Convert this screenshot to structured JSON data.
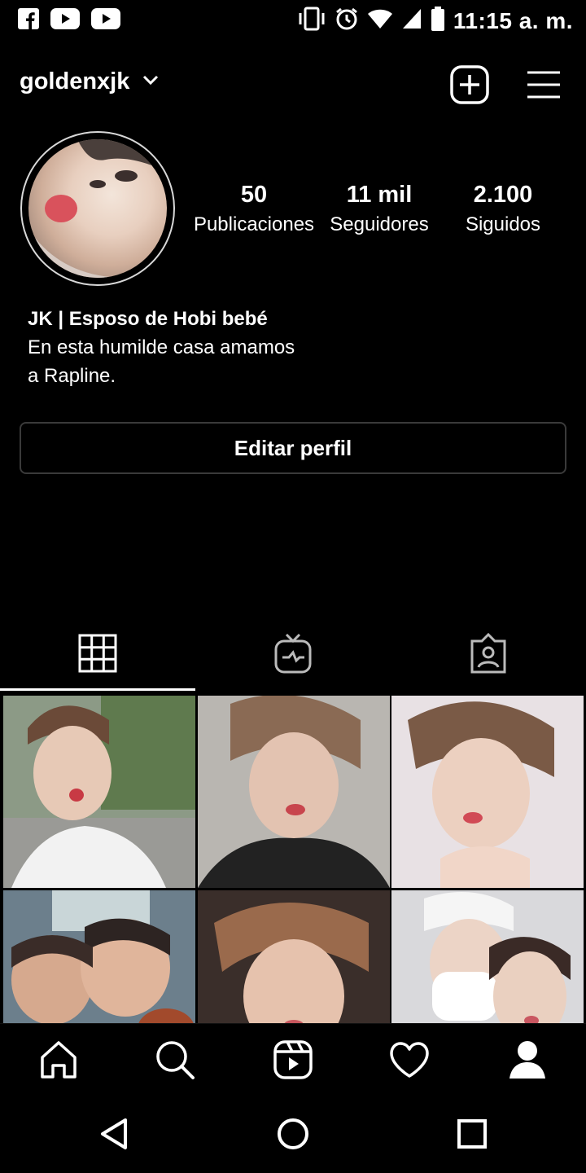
{
  "statusbar": {
    "left_icons": [
      "facebook-icon",
      "youtube-icon",
      "youtube-icon"
    ],
    "right_icons": [
      "vibrate-icon",
      "alarm-icon",
      "wifi-icon",
      "signal-icon",
      "battery-icon"
    ],
    "time": "11:15 a. m."
  },
  "header": {
    "username": "goldenxjk",
    "icons": [
      "chevron-down-icon",
      "add-post-icon",
      "menu-icon"
    ]
  },
  "profile": {
    "stats": [
      {
        "value": "50",
        "label": "Publicaciones"
      },
      {
        "value": "11 mil",
        "label": "Seguidores"
      },
      {
        "value": "2.100",
        "label": "Siguidos"
      }
    ],
    "bio_name": "JK | Esposo de Hobi bebé",
    "bio_line1": "En esta humilde casa amamos",
    "bio_line2": "a Rapline.",
    "edit_button": "Editar perfil"
  },
  "tabs": {
    "items": [
      "grid-icon",
      "igtv-icon",
      "tagged-icon"
    ],
    "active_index": 0
  },
  "bottom_nav": [
    "home-icon",
    "search-icon",
    "reels-icon",
    "heart-icon",
    "profile-icon"
  ],
  "system_nav": [
    "back-icon",
    "home-circle-icon",
    "recents-icon"
  ],
  "colors": {
    "background": "#000000",
    "text": "#ffffff",
    "border": "#3a3a3a"
  }
}
